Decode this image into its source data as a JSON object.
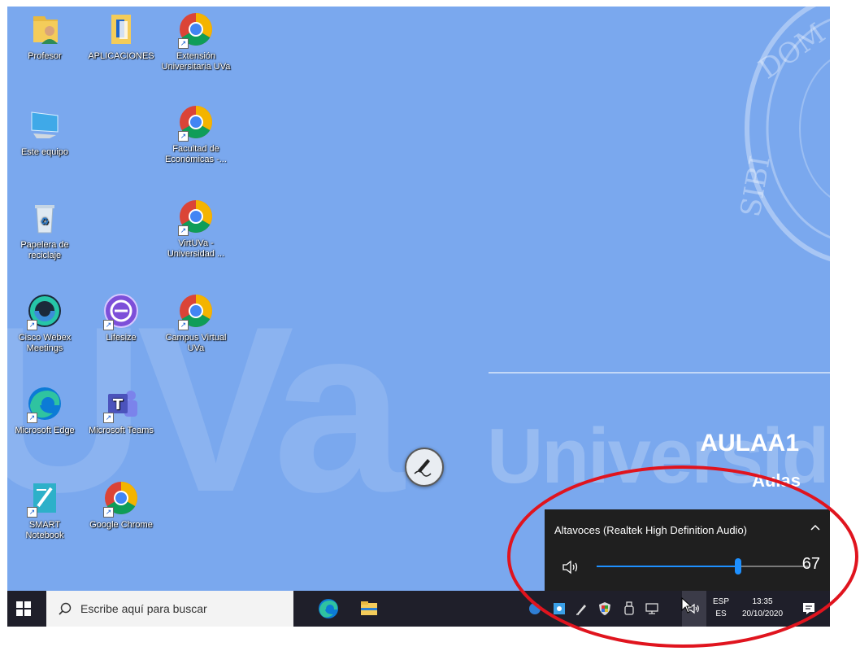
{
  "desktop": {
    "watermark_big": "UVa",
    "watermark_word": "Universida",
    "aula_title": "AULAA1",
    "aula_sub": "Aulas",
    "icons": {
      "profesor": "Profesor",
      "aplicaciones": "APLICACIONES",
      "extension": "Extensión Universitaria UVa",
      "este_equipo": "Este equipo",
      "facultad": "Facultad de Económicas -...",
      "papelera": "Papelera de reciclaje",
      "virtuva": "VirtUVa - Universidad ...",
      "webex": "Cisco Webex Meetings",
      "lifesize": "Lifesize",
      "campus": "Campus Virtual UVa",
      "edge": "Microsoft Edge",
      "teams": "Microsoft Teams",
      "smart": "SMART Notebook",
      "chrome": "Google Chrome"
    }
  },
  "volume_flyout": {
    "device": "Altavoces (Realtek High Definition Audio)",
    "volume": 67
  },
  "taskbar": {
    "search_placeholder": "Escribe aquí para buscar",
    "lang_top": "ESP",
    "lang_bottom": "ES",
    "time": "13:35",
    "date": "20/10/2020"
  },
  "colors": {
    "desktop_bg": "#7aa8ee",
    "accent": "#1e90ff",
    "taskbar_bg": "#1f1f2a",
    "annotation": "#e0141e"
  }
}
